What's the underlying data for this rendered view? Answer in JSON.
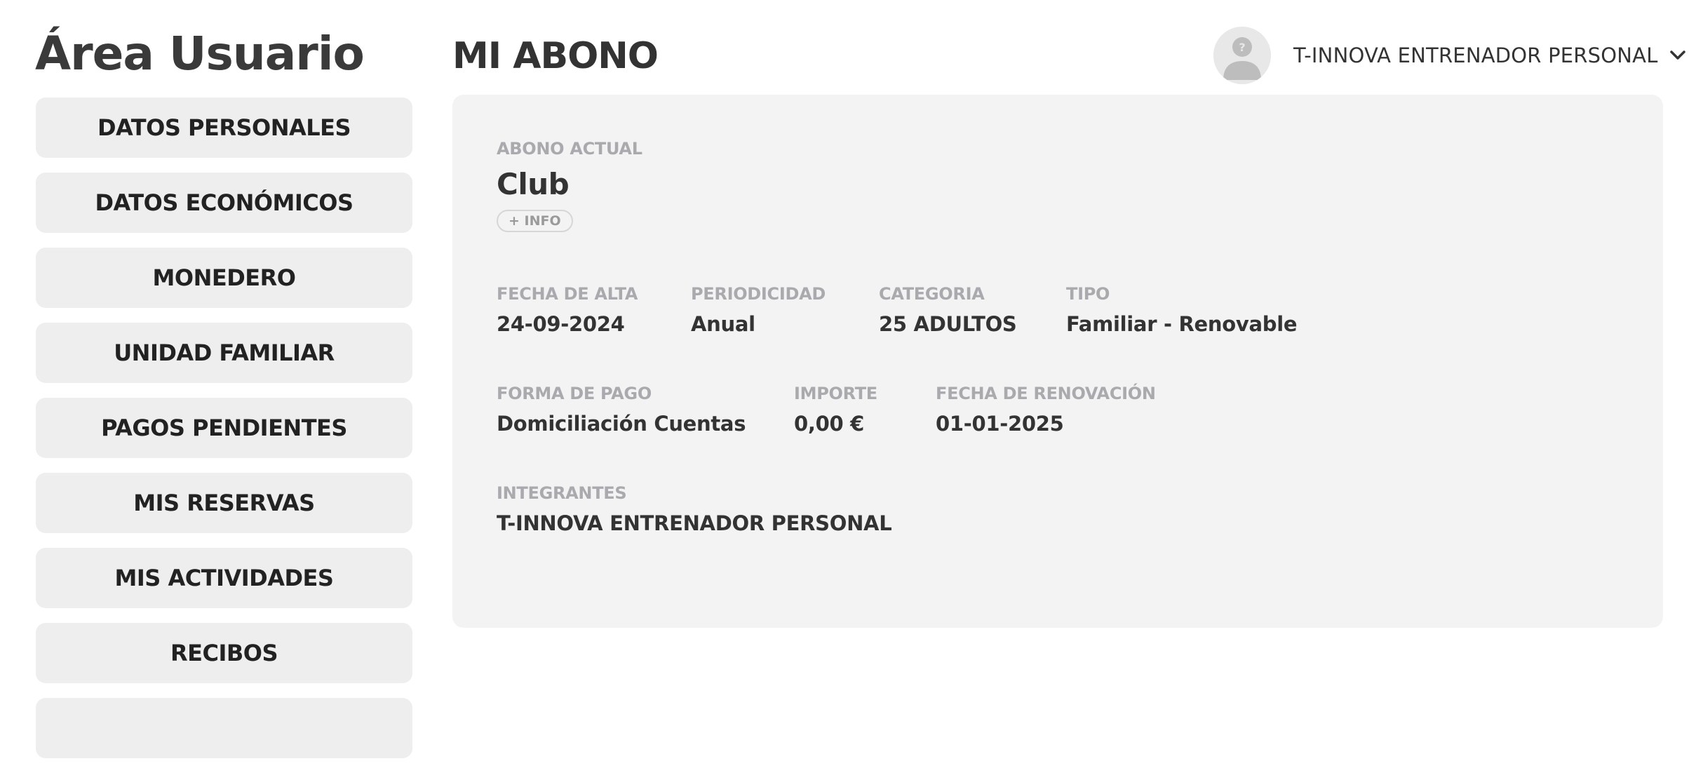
{
  "sidebar": {
    "title": "Área Usuario",
    "items": [
      {
        "label": "DATOS PERSONALES"
      },
      {
        "label": "DATOS ECONÓMICOS"
      },
      {
        "label": "MONEDERO"
      },
      {
        "label": "UNIDAD FAMILIAR"
      },
      {
        "label": "PAGOS PENDIENTES"
      },
      {
        "label": "MIS RESERVAS"
      },
      {
        "label": "MIS ACTIVIDADES"
      },
      {
        "label": "RECIBOS"
      },
      {
        "label": ""
      }
    ]
  },
  "header": {
    "title": "MI ABONO",
    "user_name": "T-INNOVA ENTRENADOR PERSONAL",
    "avatar_icon": "user-placeholder-icon",
    "menu_icon": "chevron-down-icon"
  },
  "abono": {
    "current_label": "ABONO ACTUAL",
    "plan_name": "Club",
    "info_button": "+ INFO",
    "fields": [
      {
        "label": "FECHA DE ALTA",
        "value": "24-09-2024"
      },
      {
        "label": "PERIODICIDAD",
        "value": "Anual"
      },
      {
        "label": "CATEGORIA",
        "value": "25 ADULTOS"
      },
      {
        "label": "TIPO",
        "value": "Familiar - Renovable"
      },
      {
        "label": "FORMA DE PAGO",
        "value": "Domiciliación Cuentas"
      },
      {
        "label": "IMPORTE",
        "value": "0,00 €"
      },
      {
        "label": "FECHA DE RENOVACIÓN",
        "value": "01-01-2025"
      },
      {
        "label": "INTEGRANTES",
        "value": "T-INNOVA ENTRENADOR PERSONAL"
      }
    ]
  },
  "colors": {
    "button_bg": "#eeeeee",
    "card_bg": "#f3f3f3",
    "label_gray": "#a9a9ae",
    "text_dark": "#333333"
  }
}
